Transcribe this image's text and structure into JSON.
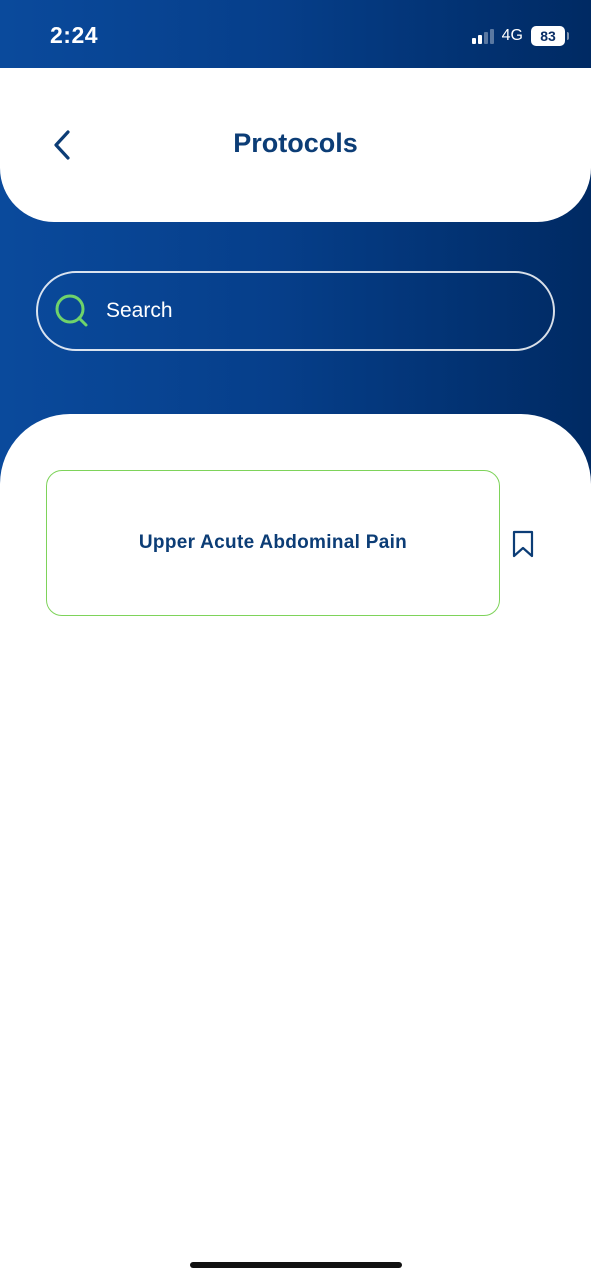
{
  "status_bar": {
    "time": "2:24",
    "network": "4G",
    "battery": "83"
  },
  "header": {
    "title": "Protocols",
    "back_icon": "chevron-left-icon"
  },
  "search": {
    "placeholder": "Search",
    "icon": "search-icon"
  },
  "protocols": [
    {
      "label": "Upper Acute Abdominal Pain",
      "bookmark_icon": "bookmark-icon"
    }
  ],
  "colors": {
    "primary": "#0c3d76",
    "accent": "#7ed35a",
    "background_gradient_start": "#0a4a9c",
    "background_gradient_end": "#002a63"
  }
}
